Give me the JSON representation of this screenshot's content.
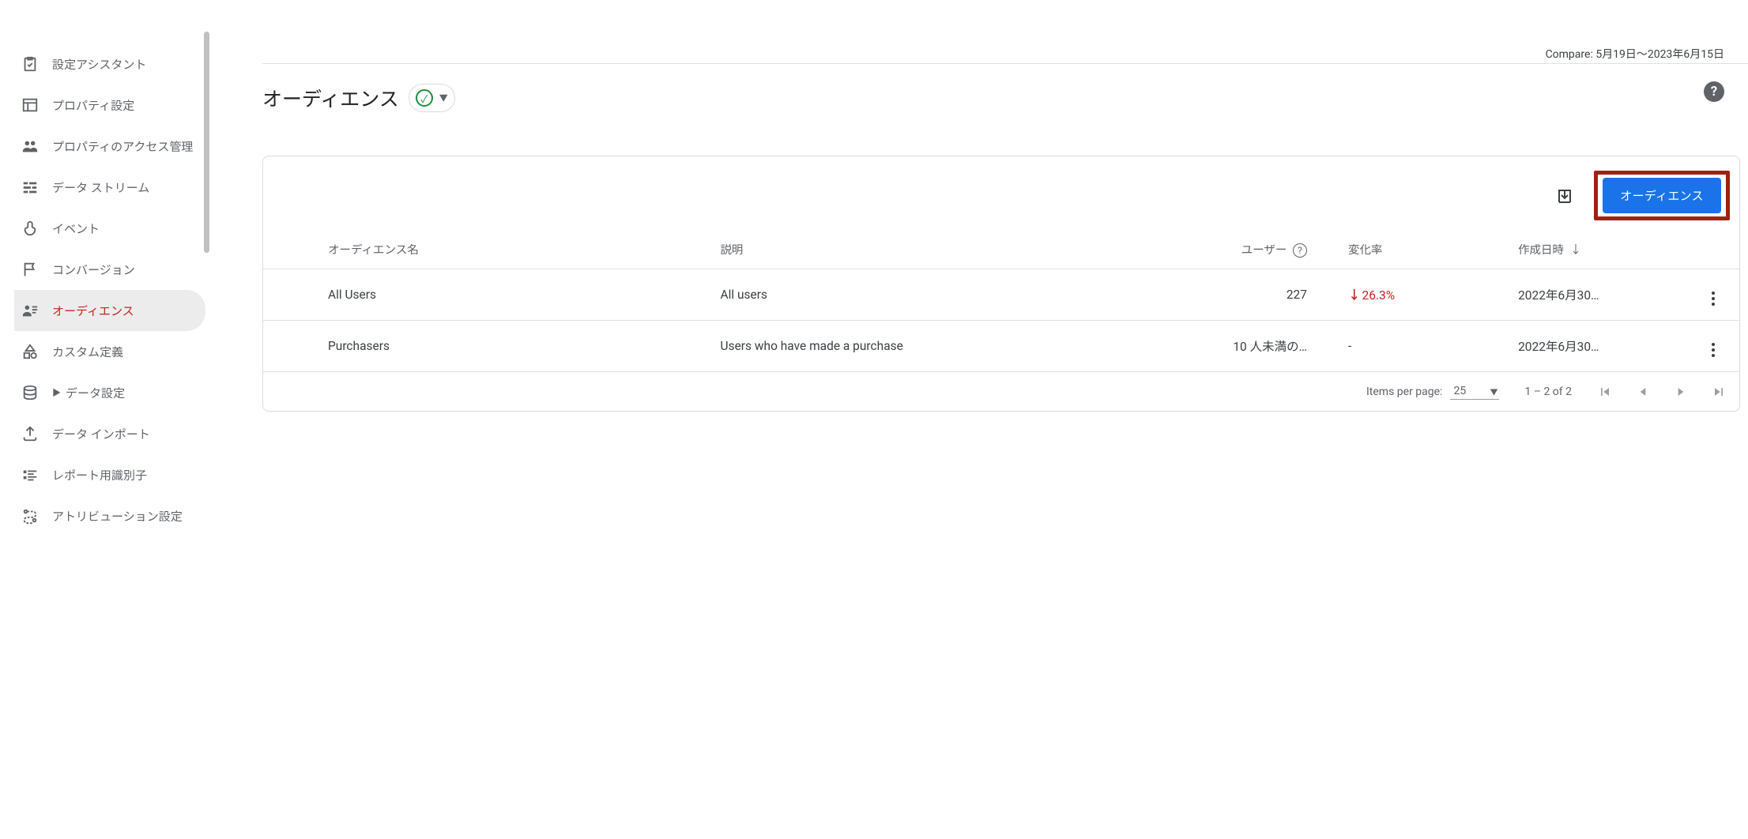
{
  "sidebar": {
    "items": [
      {
        "label": "設定アシスタント"
      },
      {
        "label": "プロパティ設定"
      },
      {
        "label": "プロパティのアクセス管理"
      },
      {
        "label": "データ ストリーム"
      },
      {
        "label": "イベント"
      },
      {
        "label": "コンバージョン"
      },
      {
        "label": "オーディエンス"
      },
      {
        "label": "カスタム定義"
      },
      {
        "label": "データ設定"
      },
      {
        "label": "データ インポート"
      },
      {
        "label": "レポート用識別子"
      },
      {
        "label": "アトリビューション設定"
      }
    ]
  },
  "header": {
    "compare_text": "Compare: 5月19日～2023年6月15日",
    "title": "オーディエンス"
  },
  "toolbar": {
    "create_label": "オーディエンス"
  },
  "table": {
    "headers": {
      "name": "オーディエンス名",
      "description": "説明",
      "users": "ユーザー",
      "rate": "変化率",
      "created": "作成日時"
    },
    "rows": [
      {
        "name": "All Users",
        "description": "All users",
        "users": "227",
        "rate": "26.3%",
        "rate_direction": "down",
        "created": "2022年6月30…"
      },
      {
        "name": "Purchasers",
        "description": "Users who have made a purchase",
        "users": "10 人未満の…",
        "rate": "-",
        "rate_direction": "none",
        "created": "2022年6月30…"
      }
    ]
  },
  "paginator": {
    "items_per_page_label": "Items per page:",
    "page_size": "25",
    "range": "1 – 2 of 2"
  }
}
